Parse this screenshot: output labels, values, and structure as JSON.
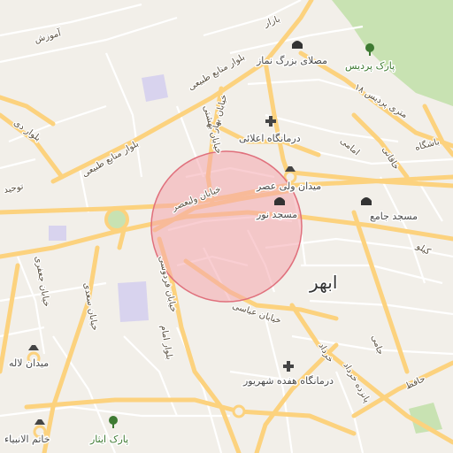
{
  "map": {
    "city_label": "ابهر",
    "colors": {
      "background": "#f2efe9",
      "road_major": "#fcd27e",
      "road_minor": "#ffffff",
      "park": "#c8e2b2",
      "water": "#d8d3ee",
      "highlight_fill": "#f4a6ad",
      "highlight_stroke": "#e0707c"
    },
    "highlight_circle": {
      "shape": "circle",
      "meaning": "selected area"
    },
    "pois": [
      {
        "icon": "mosque-icon",
        "label": "مصلای بزرگ نماز"
      },
      {
        "icon": "tree-icon",
        "label": "پارک پردیس"
      },
      {
        "icon": "hospital-cross-icon",
        "label": "درمانگاه اعلائی"
      },
      {
        "icon": "monument-icon",
        "label": "میدان ولی عصر"
      },
      {
        "icon": "mosque-icon",
        "label": "مسجد نور"
      },
      {
        "icon": "mosque-icon",
        "label": "مسجد جامع"
      },
      {
        "icon": "monument-icon",
        "label": "میدان لاله"
      },
      {
        "icon": "hospital-cross-icon",
        "label": "درمانگاه هفده شهریور"
      },
      {
        "icon": "tree-icon",
        "label": "پارک ایثار"
      },
      {
        "icon": "monument-icon",
        "label": "خاتم الانبیاء"
      }
    ],
    "roads": [
      {
        "label": "بلوار منابع طبیعی"
      },
      {
        "label": "بلوار منابع طبیعی"
      },
      {
        "label": "بلوار دی"
      },
      {
        "label": "توحید"
      },
      {
        "label": "خیابان ولیعصر"
      },
      {
        "label": "خیابان بهار"
      },
      {
        "label": "خیابان بهشتی"
      },
      {
        "label": "خیابان عباسی"
      },
      {
        "label": "خیابان فردوسی"
      },
      {
        "label": "خیابان جعفری"
      },
      {
        "label": "خیابان سعدی"
      },
      {
        "label": "بلوار امام"
      },
      {
        "label": "۱۸ متری پردیس"
      },
      {
        "label": "خاقانی"
      },
      {
        "label": "امامی"
      },
      {
        "label": "باشگاه"
      },
      {
        "label": "کیلو"
      },
      {
        "label": "بازار"
      },
      {
        "label": "خرداد"
      },
      {
        "label": "پانزده خرداد"
      },
      {
        "label": "جامی"
      },
      {
        "label": "حافظ"
      },
      {
        "label": "آموزش"
      }
    ]
  }
}
